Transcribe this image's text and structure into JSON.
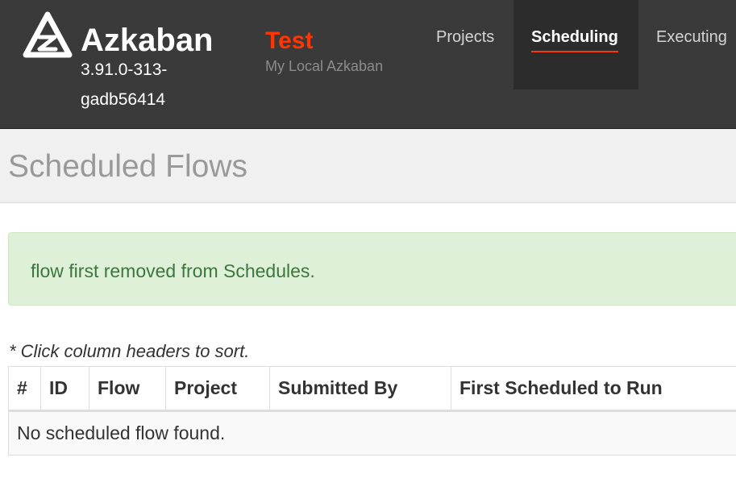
{
  "navbar": {
    "brand_name": "Azkaban",
    "brand_version": "3.91.0-313-gadb56414",
    "env_name": "Test",
    "env_description": "My Local Azkaban",
    "logo_icon": "azkaban-logo-icon",
    "nav_items": [
      {
        "label": "Projects",
        "active": false
      },
      {
        "label": "Scheduling",
        "active": true
      },
      {
        "label": "Executing",
        "active": false
      }
    ],
    "accent_color": "#ff3601"
  },
  "page": {
    "title": "Scheduled Flows"
  },
  "alert": {
    "message": "flow first removed from Schedules.",
    "type": "success"
  },
  "table": {
    "hint": "* Click column headers to sort.",
    "columns": [
      "#",
      "ID",
      "Flow",
      "Project",
      "Submitted By",
      "First Scheduled to Run"
    ],
    "empty_message": "No scheduled flow found."
  }
}
